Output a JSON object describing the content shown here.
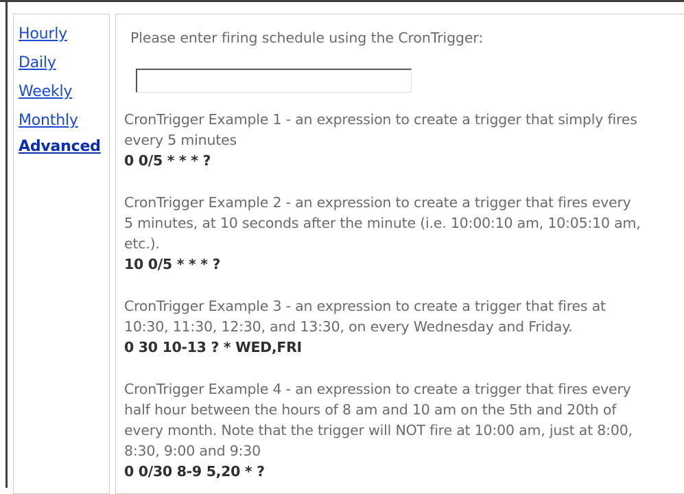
{
  "sidebar": {
    "items": [
      {
        "label": "Hourly"
      },
      {
        "label": "Daily"
      },
      {
        "label": "Weekly"
      },
      {
        "label": "Monthly"
      },
      {
        "label": "Advanced"
      }
    ]
  },
  "main": {
    "prompt": "Please enter firing schedule using the CronTrigger:",
    "input_value": "",
    "examples": [
      {
        "lines": [
          "CronTrigger Example 1 - an expression to create a trigger that simply fires",
          "every 5 minutes"
        ],
        "expression": "0 0/5 * * * ?"
      },
      {
        "lines": [
          "CronTrigger Example 2 - an expression to create a trigger that fires every",
          "5 minutes, at 10 seconds after the minute (i.e. 10:00:10 am, 10:05:10 am,",
          "etc.)."
        ],
        "expression": "10 0/5 * * * ?"
      },
      {
        "lines": [
          "CronTrigger Example 3 - an expression to create a trigger that fires at",
          "10:30, 11:30, 12:30, and 13:30, on every Wednesday and Friday."
        ],
        "expression": "0 30 10-13 ? * WED,FRI"
      },
      {
        "lines": [
          "CronTrigger Example 4 - an expression to create a trigger that fires every",
          "half hour between the hours of 8 am and 10 am on the 5th and 20th of",
          "every month. Note that the trigger will NOT fire at 10:00 am, just at 8:00,",
          "8:30, 9:00 and 9:30"
        ],
        "expression": "0 0/30 8-9 5,20 * ?"
      }
    ]
  }
}
